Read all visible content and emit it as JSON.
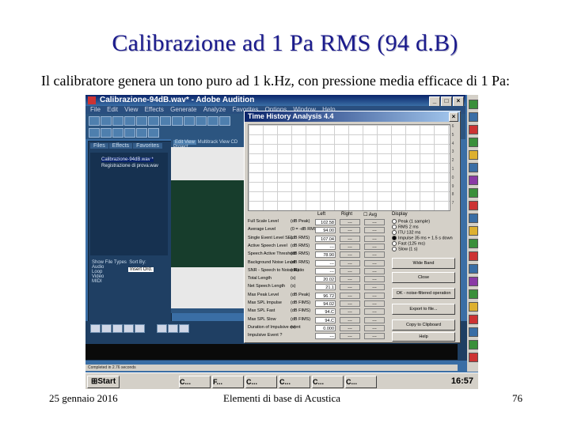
{
  "slide": {
    "title": "Calibrazione ad 1 Pa RMS (94 d.B)",
    "body": "Il calibratore genera un tono puro ad 1 k.Hz, con pressione media efficace di 1 Pa:",
    "footer_date": "25 gennaio 2016",
    "footer_center": "Elementi di base di Acustica",
    "page_number": "76"
  },
  "screenshot": {
    "window_title": "Calibrazione-94dB.wav* - Adobe Audition",
    "menu": [
      "File",
      "Edit",
      "View",
      "Effects",
      "Generate",
      "Analyze",
      "Favorites",
      "Options",
      "Window",
      "Help"
    ],
    "left_tabs": [
      "Files",
      "Effects",
      "Favorites"
    ],
    "files": [
      "Calibrazione-94dB.wav *",
      "Registrazione di prova.wav"
    ],
    "show_file_types_label": "Show File Types",
    "file_types": [
      "Audio",
      "Loop",
      "Video",
      "MIDI"
    ],
    "sort_by_label": "Sort By:",
    "sort_by_value": "Insert Ord.",
    "view_tabs": [
      "Edit View",
      "Multitrack View",
      "CD Project"
    ],
    "status_text": "Completed in 2.76 seconds",
    "taskbar": {
      "start": "Start",
      "tasks": [
        "C...",
        "F...",
        "C...",
        "C...",
        "C...",
        "C..."
      ],
      "clock": "16:57"
    },
    "dialog": {
      "title": "Time History Analysis 4.4",
      "scale": [
        "6",
        "5",
        "4",
        "3",
        "2",
        "1",
        "0",
        "9",
        "8",
        "7"
      ],
      "col_left": "Left",
      "col_right": "Right",
      "col_avg": "Avg",
      "display_label": "Display",
      "rows": [
        {
          "label": "Full Scale Level",
          "unit": "(dB Peak)",
          "left": "102.58",
          "right": "---",
          "avg": "---"
        },
        {
          "label": "Average Level",
          "unit": "(0 = -dB RMS)",
          "left": "94.00",
          "right": "---",
          "avg": "---"
        },
        {
          "label": "Single Event Level SEL",
          "unit": "(dB RMS)",
          "left": "107.04",
          "right": "---",
          "avg": "---"
        },
        {
          "label": "Active Speech Level",
          "unit": "(dB RMS)",
          "left": "---",
          "right": "---",
          "avg": "---"
        },
        {
          "label": "Speech Active Threshold",
          "unit": "(dB RMS)",
          "left": "78.90",
          "right": "---",
          "avg": "---"
        },
        {
          "label": "Background Noise Level",
          "unit": "(dB RMS)",
          "left": "---",
          "right": "---",
          "avg": "---"
        },
        {
          "label": "SNR - Speech to Noise Ratio",
          "unit": "(dB)",
          "left": "---",
          "right": "---",
          "avg": "---"
        },
        {
          "label": "Total Length",
          "unit": "(s)",
          "left": "20.02",
          "right": "---",
          "avg": "---"
        },
        {
          "label": "Net Speech Length",
          "unit": "(s)",
          "left": "21.1",
          "right": "---",
          "avg": "---"
        },
        {
          "label": "Max Peak Level",
          "unit": "(dB Peak)",
          "left": "96.72",
          "right": "---",
          "avg": "---"
        },
        {
          "label": "Max SPL Impulse",
          "unit": "(dB FIMS)",
          "left": "94.02",
          "right": "---",
          "avg": "---"
        },
        {
          "label": "Max SPL Fast",
          "unit": "(dB FIMS)",
          "left": "94.C",
          "right": "---",
          "avg": "---"
        },
        {
          "label": "Max SPL Slow",
          "unit": "(dB FIMS)",
          "left": "94.C",
          "right": "---",
          "avg": "---"
        },
        {
          "label": "Duration of Impulsive event",
          "unit": "(s)",
          "left": "0.000",
          "right": "---",
          "avg": "---"
        },
        {
          "label": "Impulsive Event ?",
          "unit": "",
          "left": "---",
          "right": "---",
          "avg": "---"
        }
      ],
      "display_options": [
        {
          "label": "Peak (1 sample)",
          "selected": false
        },
        {
          "label": "RMS 2 ms",
          "selected": false
        },
        {
          "label": "ITU 132 ms",
          "selected": false
        },
        {
          "label": "Impulse 35 ms + 1.5 s down",
          "selected": true
        },
        {
          "label": "Fast (125 ms)",
          "selected": false
        },
        {
          "label": "Slow (1 s)",
          "selected": false
        }
      ],
      "buttons": [
        "Wide Band",
        "Close",
        "OK - noise-filtered operation",
        "Export to file...",
        "Copy to Clipboard",
        "Help"
      ]
    }
  }
}
